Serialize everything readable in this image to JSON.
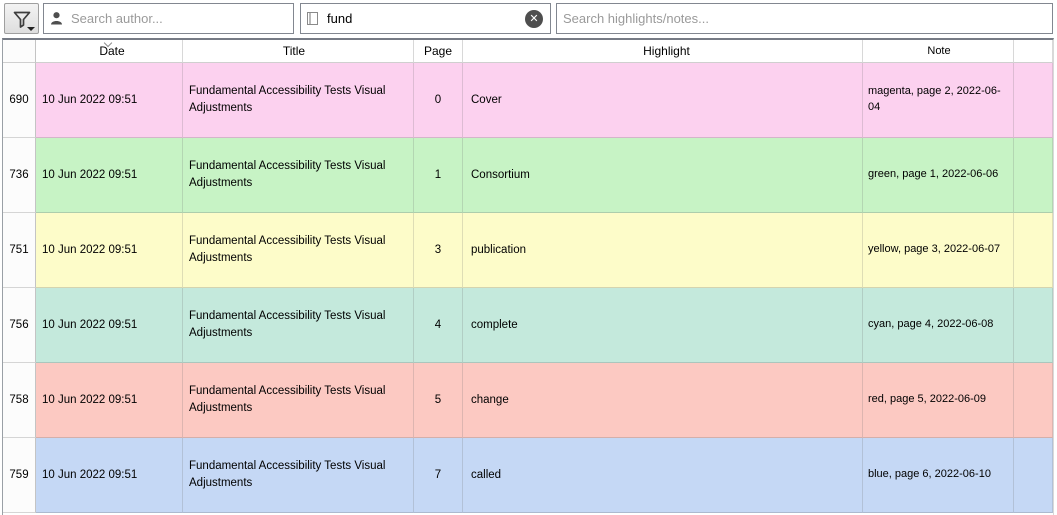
{
  "toolbar": {
    "filter_button": {
      "icon": "funnel-icon",
      "dropdown_icon": "caret-down-icon"
    },
    "author_search": {
      "placeholder": "Search author...",
      "value": "",
      "icon": "person-icon"
    },
    "book_search": {
      "value": "fund",
      "icon": "book-icon",
      "clear_icon": "circle-x-icon",
      "clear_glyph": "✕"
    },
    "notes_search": {
      "placeholder": "Search highlights/notes...",
      "value": ""
    }
  },
  "table": {
    "columns": [
      "Date",
      "Title",
      "Page",
      "Highlight",
      "Note"
    ],
    "sorted_by": "Date",
    "rows": [
      {
        "num": "690",
        "date": "10 Jun 2022 09:51",
        "title": "Fundamental Accessibility Tests Visual Adjustments",
        "page": "0",
        "highlight": "Cover",
        "note": "magenta, page 2, 2022-06-04",
        "color": "#fcd1ef"
      },
      {
        "num": "736",
        "date": "10 Jun 2022 09:51",
        "title": "Fundamental Accessibility Tests Visual Adjustments",
        "page": "1",
        "highlight": "Consortium",
        "note": "green, page 1, 2022-06-06",
        "color": "#c7f3c5"
      },
      {
        "num": "751",
        "date": "10 Jun 2022 09:51",
        "title": "Fundamental Accessibility Tests Visual Adjustments",
        "page": "3",
        "highlight": "publication",
        "note": "yellow, page 3, 2022-06-07",
        "color": "#fdfcc9"
      },
      {
        "num": "756",
        "date": "10 Jun 2022 09:51",
        "title": "Fundamental Accessibility Tests Visual Adjustments",
        "page": "4",
        "highlight": "complete",
        "note": "cyan, page 4, 2022-06-08",
        "color": "#c4e9dc"
      },
      {
        "num": "758",
        "date": "10 Jun 2022 09:51",
        "title": "Fundamental Accessibility Tests Visual Adjustments",
        "page": "5",
        "highlight": "change",
        "note": "red, page 5, 2022-06-09",
        "color": "#fcc9c2"
      },
      {
        "num": "759",
        "date": "10 Jun 2022 09:51",
        "title": "Fundamental Accessibility Tests Visual Adjustments",
        "page": "7",
        "highlight": "called",
        "note": "blue, page 6, 2022-06-10",
        "color": "#c5d8f5"
      }
    ]
  },
  "colors": {
    "row_magenta": "#fcd1ef",
    "row_green": "#c7f3c5",
    "row_yellow": "#fdfcc9",
    "row_cyan": "#c4e9dc",
    "row_red": "#fcc9c2",
    "row_blue": "#c5d8f5",
    "frame_border": "#767b85",
    "input_border": "#828790"
  }
}
